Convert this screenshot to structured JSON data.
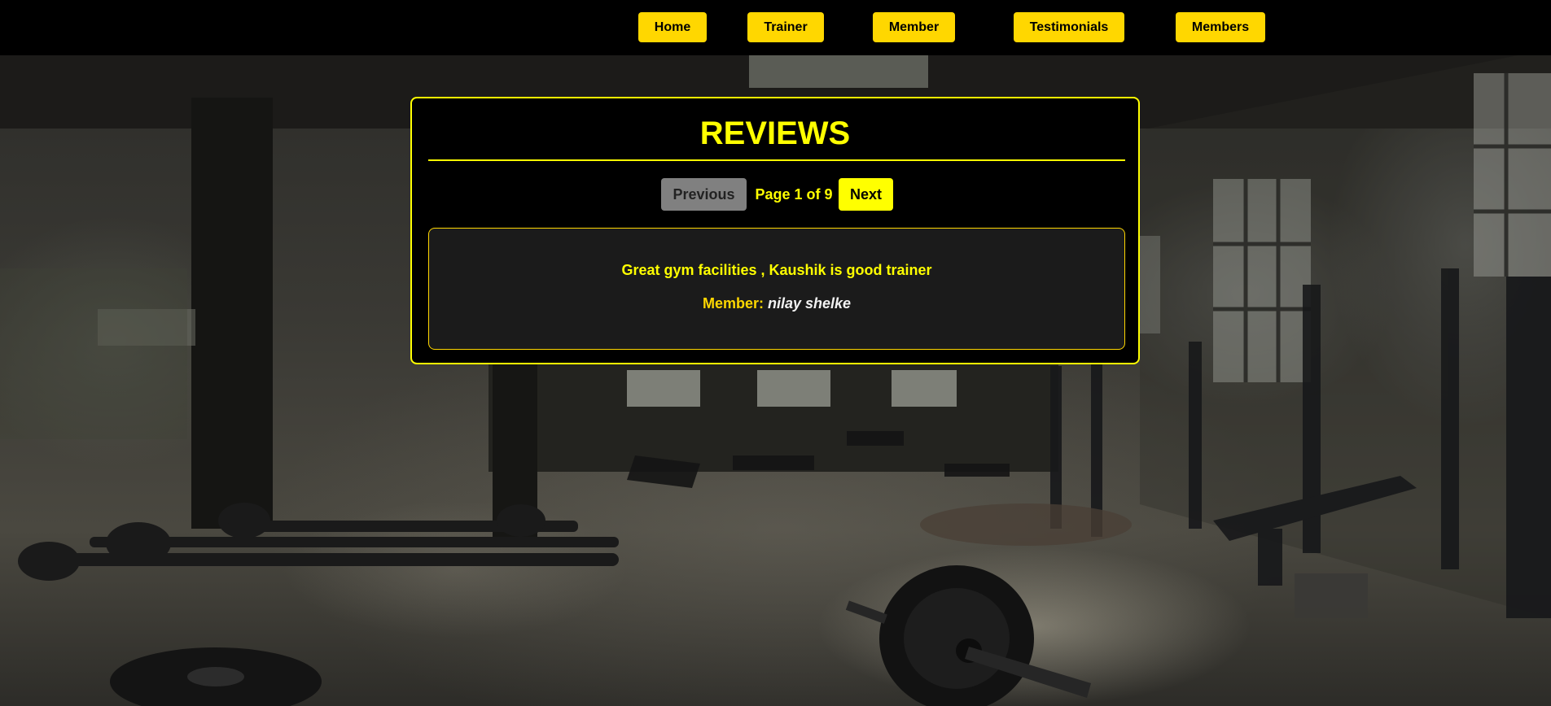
{
  "nav": {
    "items": [
      {
        "label": "Home"
      },
      {
        "label": "Trainer"
      },
      {
        "label": "Member"
      },
      {
        "label": "Testimonials"
      },
      {
        "label": "Members"
      }
    ]
  },
  "reviews": {
    "title": "REVIEWS",
    "pagination": {
      "previous_label": "Previous",
      "page_text": "Page 1 of 9",
      "next_label": "Next",
      "current_page": 1,
      "total_pages": 9
    },
    "items": [
      {
        "text": "Great gym facilities , Kaushik is good trainer",
        "member_label": "Member:",
        "member_name": "nilay shelke"
      }
    ]
  },
  "background": {
    "icon": "gym-interior-photo"
  },
  "colors": {
    "accent": "#ffff00",
    "nav_button": "#ffd700",
    "panel_bg": "#000000",
    "card_bg": "#1b1b1b",
    "disabled_button": "#808080"
  }
}
